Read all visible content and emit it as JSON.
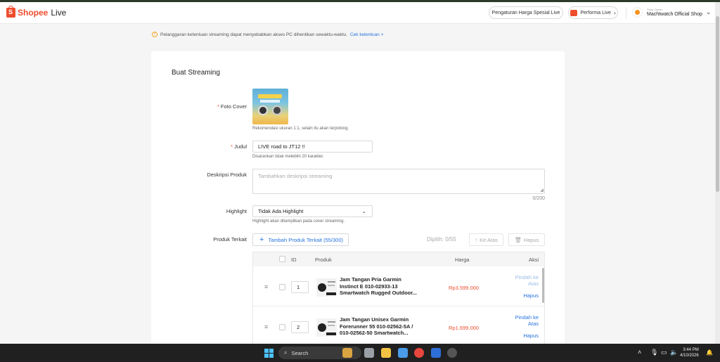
{
  "header": {
    "brand": "Shopee",
    "product": "Live",
    "harga_button": "Pengaturan Harga Spesial Live",
    "performa_button": "Performa Live",
    "shop_role": "Shop Owner",
    "shop_name": "Machtwatch Official Shop"
  },
  "notice": {
    "text": "Pelanggaran ketentuan streaming dapat menyebabkan akses PC dihentikan sewaktu-waktu.",
    "link": "Cek ketentuan >"
  },
  "form": {
    "title": "Buat Streaming",
    "cover_label": "Foto Cover",
    "cover_hint": "Rekomendasi ukuran 1:1, selain itu akan terpotong.",
    "judul_label": "Judul",
    "judul_value": "LIVE road to JT12 !!",
    "judul_hint": "Disarankan tidak melebihi 20 karakter.",
    "desc_label": "Deskripsi Produk",
    "desc_placeholder": "Tambahkan deskripsi streaming",
    "desc_count": "0/200",
    "highlight_label": "Highlight",
    "highlight_value": "Tidak Ada Highlight",
    "highlight_hint": "Highlight akan ditampilkan pada cover streaming.",
    "produk_label": "Produk Terkait",
    "add_button": "Tambah Produk Terkait (55/300)",
    "dipilih": "Dipilih: 0/55",
    "ke_atas": "Ke Atas",
    "hapus": "Hapus"
  },
  "table": {
    "columns": [
      "ID",
      "Produk",
      "Harga",
      "Aksi"
    ],
    "rows": [
      {
        "id": "1",
        "name": "Jam Tangan Pria Garmin Instinct E 010-02933-13 Smartwatch Rugged Outdoor...",
        "price": "Rp3.599.000",
        "action_move": "Pindah ke Atas",
        "action_delete": "Hapus"
      },
      {
        "id": "2",
        "name": "Jam Tangan Unisex Garmin Forerunner 55 010-02562-5A / 010-02562-50 Smartwatch...",
        "price": "Rp1.699.000",
        "action_move": "Pindah ke Atas",
        "action_delete": "Hapus"
      }
    ]
  },
  "taskbar": {
    "search_label": "Search",
    "time": "3:44 PM",
    "date": "4/10/2026"
  },
  "colors": {
    "brand": "#ee4d2d",
    "link": "#2673dd"
  }
}
